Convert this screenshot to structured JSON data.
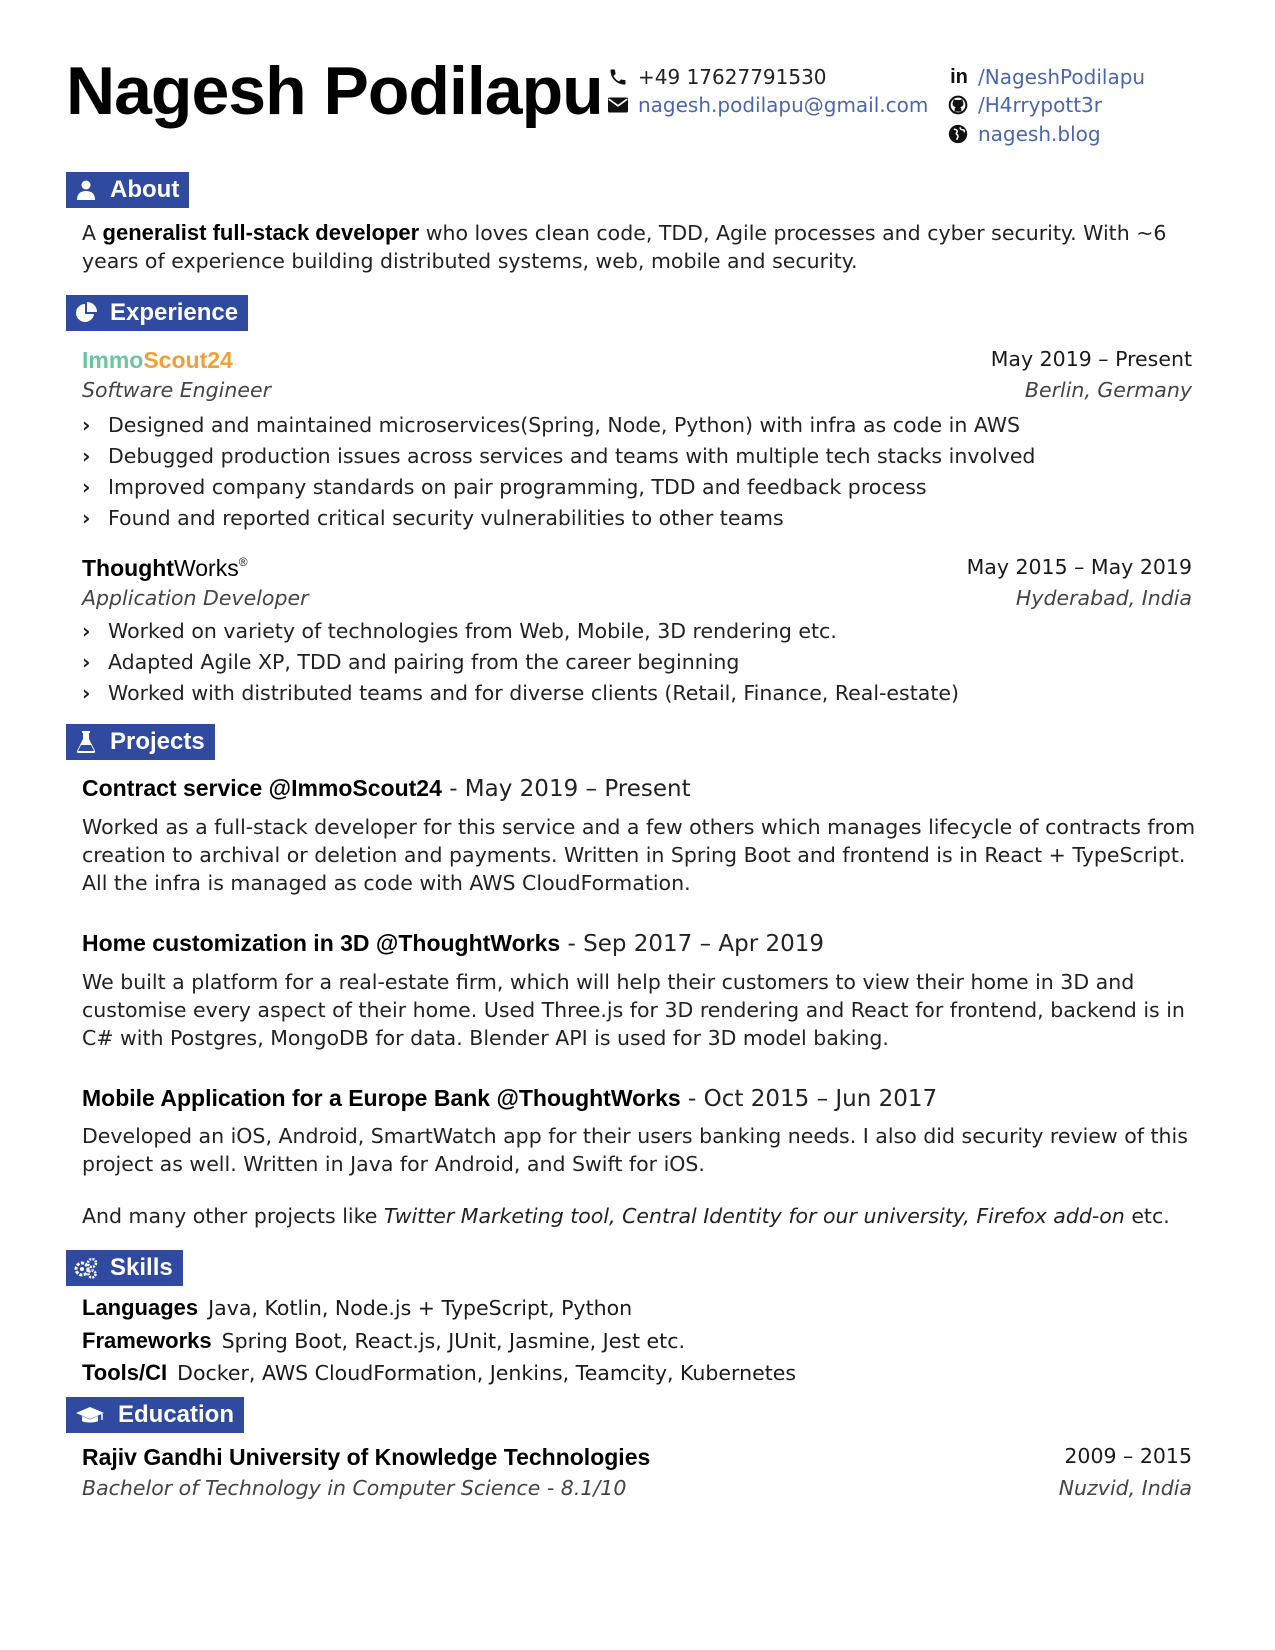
{
  "header": {
    "name": "Nagesh Podilapu",
    "phone": "+49 17627791530",
    "email": "nagesh.podilapu@gmail.com",
    "linkedin": "/NageshPodilapu",
    "github": "/H4rrypott3r",
    "website": "nagesh.blog"
  },
  "colors": {
    "accent": "#2f4a9e",
    "link": "#4a66ad",
    "immo_green": "#6cc5a0",
    "immo_orange": "#f0a038"
  },
  "about": {
    "heading": "About",
    "icon": "user-icon",
    "text_pre": "A ",
    "text_bold": "generalist full-stack developer",
    "text_post": " who loves clean code, TDD, Agile processes and cyber security. With ~6 years of experience building distributed systems, web, mobile and security."
  },
  "experience": {
    "heading": "Experience",
    "icon": "pie-chart-icon",
    "jobs": [
      {
        "company_part1": "Immo",
        "company_part2": "Scout24",
        "title": "Software Engineer",
        "dates": "May 2019 – Present",
        "location": "Berlin, Germany",
        "bullets": [
          "Designed and maintained microservices(Spring, Node, Python) with infra as code in AWS",
          "Debugged production issues across services and teams with multiple tech stacks involved",
          "Improved company standards on pair programming, TDD and feedback process",
          "Found and reported critical security vulnerabilities to other teams"
        ]
      },
      {
        "company_part1": "Thought",
        "company_part2": "Works",
        "company_mark": "®",
        "title": "Application Developer",
        "dates": "May 2015 – May 2019",
        "location": "Hyderabad, India",
        "bullets": [
          "Worked on variety of technologies from Web, Mobile, 3D rendering etc.",
          "Adapted Agile XP, TDD and pairing from the career beginning",
          "Worked with distributed teams and for diverse clients (Retail, Finance, Real-estate)"
        ]
      }
    ]
  },
  "projects": {
    "heading": "Projects",
    "icon": "flask-icon",
    "items": [
      {
        "name": "Contract service @ImmoScout24",
        "dates": " - May 2019 – Present",
        "description": "Worked as a full-stack developer for this service and a few others which manages lifecycle of contracts from creation to archival or deletion and payments. Written in Spring Boot and frontend is in React + TypeScript. All the infra is managed as code with AWS CloudFormation."
      },
      {
        "name": "Home customization in 3D @ThoughtWorks",
        "dates": " - Sep 2017 – Apr 2019",
        "description": "We built a platform for a real-estate firm, which will help their customers to view their home in 3D and customise every aspect of their home. Used Three.js for 3D rendering and React for frontend, backend is in C# with Postgres, MongoDB for data. Blender API is used for 3D model baking."
      },
      {
        "name": "Mobile Application for a Europe Bank @ThoughtWorks",
        "dates": " - Oct 2015 – Jun 2017",
        "description": "Developed an iOS, Android, SmartWatch app for their users banking needs. I also did security review of this project as well. Written in Java for Android, and Swift for iOS."
      }
    ],
    "others_pre": "And many other projects like ",
    "others_italic": "Twitter Marketing tool, Central Identity for our university, Firefox add-on",
    "others_post": " etc."
  },
  "skills": {
    "heading": "Skills",
    "icon": "cogs-icon",
    "items": [
      {
        "label": "Languages",
        "value": "Java, Kotlin, Node.js + TypeScript, Python"
      },
      {
        "label": "Frameworks",
        "value": "Spring Boot, React.js, JUnit, Jasmine, Jest etc."
      },
      {
        "label": "Tools/CI",
        "value": "Docker, AWS CloudFormation, Jenkins, Teamcity, Kubernetes"
      }
    ]
  },
  "education": {
    "heading": "Education",
    "icon": "graduation-cap-icon",
    "school": "Rajiv Gandhi University of Knowledge Technologies",
    "degree": "Bachelor of Technology in Computer Science - 8.1/10",
    "dates": "2009 – 2015",
    "location": "Nuzvid, India"
  }
}
